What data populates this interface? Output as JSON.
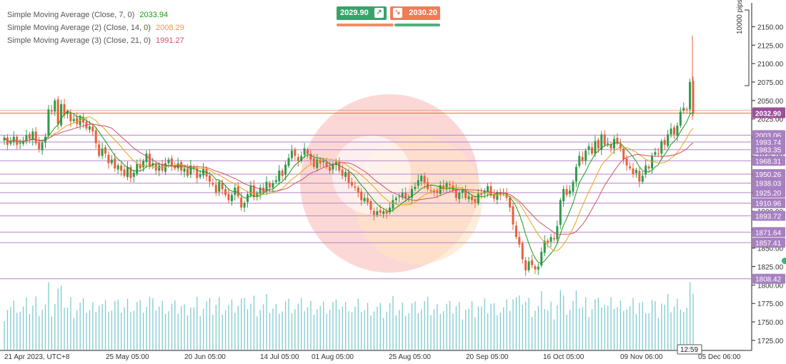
{
  "legend": [
    {
      "label": "Simple Moving Average (Close, 7, 0)",
      "value": "2033.94",
      "color": "#1a9a1a"
    },
    {
      "label": "Simple Moving Average (2) (Close, 14, 0)",
      "value": "2008.29",
      "color": "#e8a317"
    },
    {
      "label": "Simple Moving Average (3) (Close, 21, 0)",
      "value": "1991.27",
      "color": "#d0506a"
    }
  ],
  "trade_panel": {
    "buy_price": "2029.90",
    "buy_icon": "arrow-up-right-icon",
    "sell_price": "2030.20",
    "sell_icon": "arrow-down-right-icon",
    "buy_color": "#39a26a",
    "sell_color": "#ef7c57"
  },
  "pips_label": "10000 pips",
  "time_readout": "12:59",
  "colors": {
    "up": "#2e9a4a",
    "down": "#e8613a",
    "volume": "#7fcbd0",
    "level_line": "#b583c9",
    "level_label_bg": "#a77fc2",
    "current_line": "#e86a3a",
    "current_label_bg": "#9b4f9b"
  },
  "chart_data": {
    "type": "candlestick",
    "symbol_timezone": "UTC+8",
    "x_tick_labels": [
      "21 Apr 2023, UTC+8",
      "25 May 05:00",
      "20 Jun 05:00",
      "14 Jul 05:00",
      "01 Aug 05:00",
      "25 Aug 05:00",
      "20 Sep 05:00",
      "16 Oct 05:00",
      "09 Nov 06:00",
      "05 Dec 06:00"
    ],
    "y_ticks": [
      1725,
      1750,
      1775,
      1800,
      1825,
      1850,
      1875,
      1900,
      1925,
      1950,
      1975,
      2000,
      2025,
      2050,
      2075,
      2100,
      2125,
      2150
    ],
    "ylim": [
      1715,
      2160
    ],
    "current_price": "2032.90",
    "horizontal_levels": [
      "2003.06",
      "1993.74",
      "1983.35",
      "1968.31",
      "1950.26",
      "1938.03",
      "1925.20",
      "1910.96",
      "1893.72",
      "1871.64",
      "1857.41",
      "1808.42"
    ],
    "close": [
      2000,
      1990,
      1995,
      2001,
      1990,
      1993,
      1995,
      2003,
      1998,
      2008,
      1992,
      1984,
      1993,
      2001,
      2038,
      2035,
      2050,
      2018,
      2045,
      2030,
      2035,
      2022,
      2025,
      2018,
      2028,
      2020,
      2012,
      2015,
      2008,
      1992,
      1975,
      1985,
      1978,
      1965,
      1970,
      1958,
      1962,
      1955,
      1948,
      1960,
      1945,
      1952,
      1964,
      1958,
      1968,
      1978,
      1960,
      1965,
      1955,
      1962,
      1955,
      1965,
      1970,
      1962,
      1958,
      1965,
      1955,
      1958,
      1948,
      1962,
      1958,
      1945,
      1950,
      1958,
      1947,
      1940,
      1936,
      1925,
      1940,
      1930,
      1922,
      1915,
      1922,
      1932,
      1920,
      1905,
      1911,
      1923,
      1935,
      1919,
      1925,
      1932,
      1925,
      1940,
      1932,
      1938,
      1942,
      1955,
      1948,
      1963,
      1972,
      1982,
      1975,
      1968,
      1975,
      1985,
      1978,
      1970,
      1960,
      1970,
      1965,
      1968,
      1960,
      1955,
      1964,
      1967,
      1955,
      1948,
      1953,
      1938,
      1935,
      1932,
      1925,
      1915,
      1918,
      1912,
      1902,
      1895,
      1900,
      1898,
      1900,
      1897,
      1905,
      1915,
      1918,
      1920,
      1925,
      1917,
      1920,
      1930,
      1933,
      1942,
      1948,
      1938,
      1930,
      1928,
      1926,
      1925,
      1935,
      1930,
      1938,
      1935,
      1928,
      1918,
      1925,
      1928,
      1918,
      1920,
      1915,
      1912,
      1924,
      1922,
      1928,
      1934,
      1921,
      1917,
      1926,
      1922,
      1925,
      1918,
      1905,
      1882,
      1865,
      1855,
      1835,
      1820,
      1832,
      1827,
      1821,
      1825,
      1845,
      1860,
      1857,
      1865,
      1862,
      1880,
      1915,
      1930,
      1922,
      1928,
      1940,
      1960,
      1975,
      1968,
      1982,
      1988,
      1978,
      1995,
      1985,
      2004,
      1990,
      1992,
      1985,
      1998,
      1992,
      1985,
      1970,
      1962,
      1958,
      1950,
      1956,
      1940,
      1948,
      1962,
      1958,
      1975,
      1980,
      1978,
      1995,
      1990,
      2004,
      2012,
      2004,
      2016,
      2035,
      2040,
      2038,
      2075,
      2032
    ],
    "volume_scale_note": "relative tick volume"
  }
}
